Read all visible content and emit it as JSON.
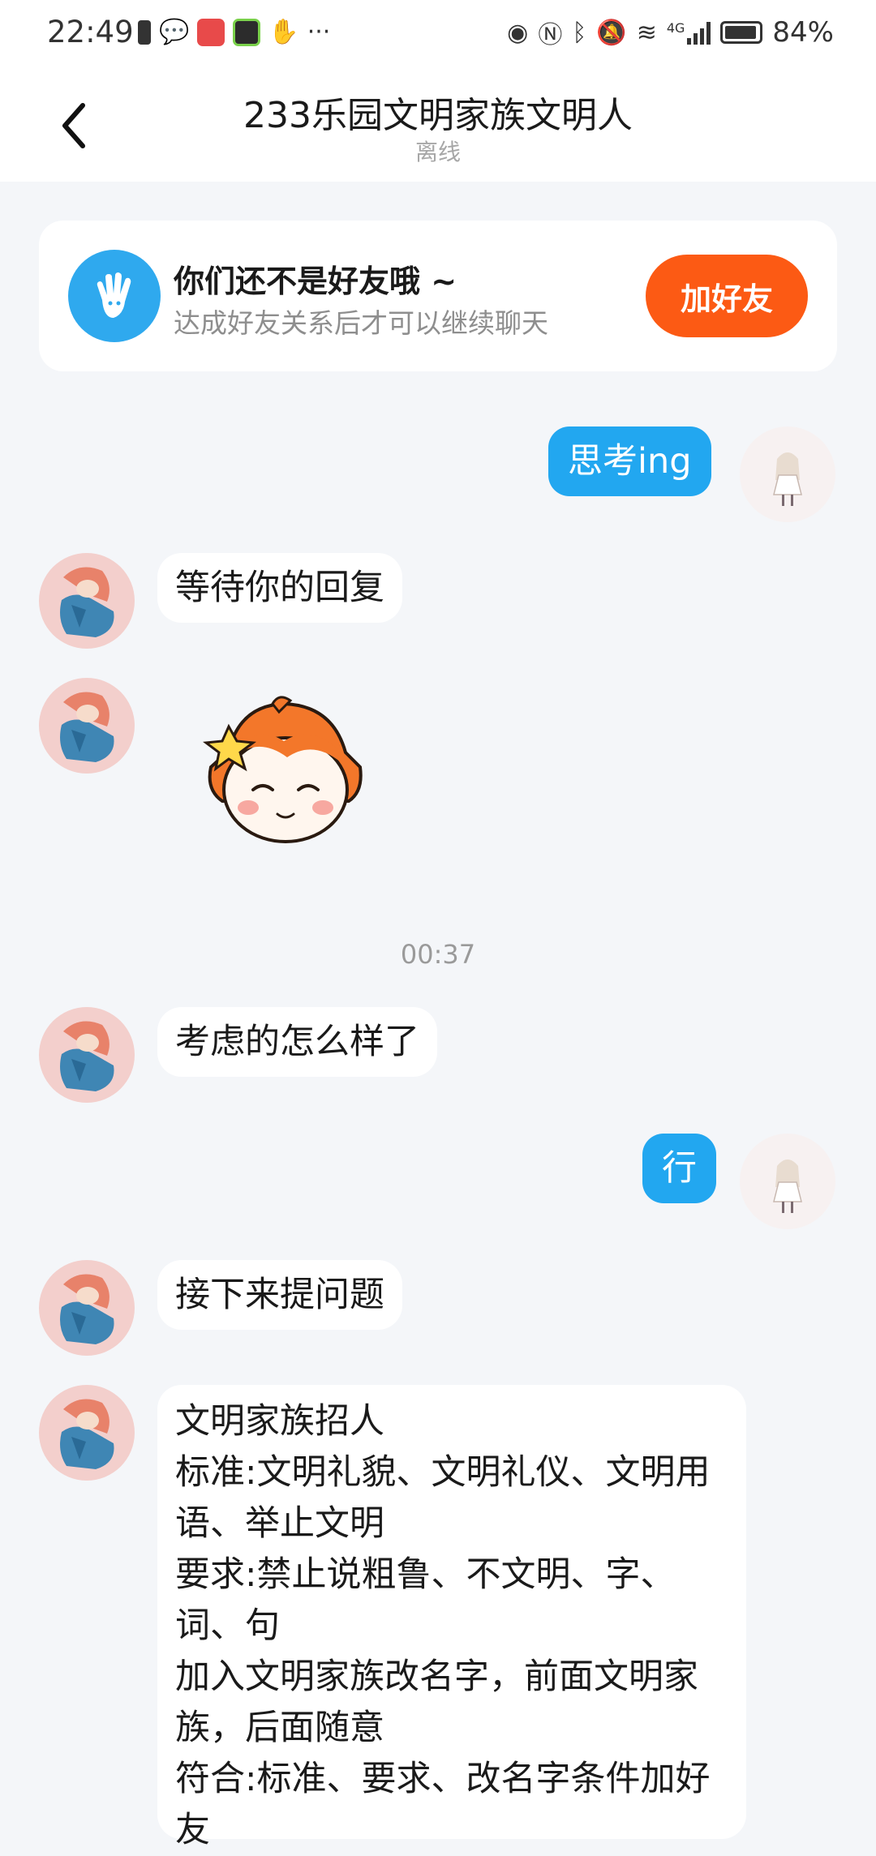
{
  "status_bar": {
    "time": "22:49",
    "battery_text": "84%",
    "icons": [
      "alert-icon",
      "wechat-icon",
      "huawei-icon",
      "game-icon",
      "hand-icon",
      "more-dots-icon",
      "eye-icon",
      "nfc-icon",
      "bluetooth-icon",
      "mute-icon",
      "wifi-icon",
      "signal-icon",
      "battery-icon"
    ],
    "network_label": "4G"
  },
  "header": {
    "title": "233乐园文明家族文明人",
    "status": "离线"
  },
  "friend_card": {
    "title": "你们还不是好友哦 ~",
    "subtitle": "达成好友关系后才可以继续聊天",
    "button": "加好友"
  },
  "messages": {
    "m1": "思考ing",
    "m2": "等待你的回复",
    "timestamp": "00:37",
    "m3": "考虑的怎么样了",
    "m4": "行",
    "m5": "接下来提问题",
    "m6": "文明家族招人\n标准:文明礼貌、文明礼仪、文明用语、举止文明\n要求:禁止说粗鲁、不文明、字、词、句\n加入文明家族改名字，前面文明家族，后面随意\n符合:标准、要求、改名字条件加好友"
  },
  "colors": {
    "accent_blue": "#22a7f0",
    "add_button": "#fc5a14",
    "background": "#f4f6f9"
  }
}
